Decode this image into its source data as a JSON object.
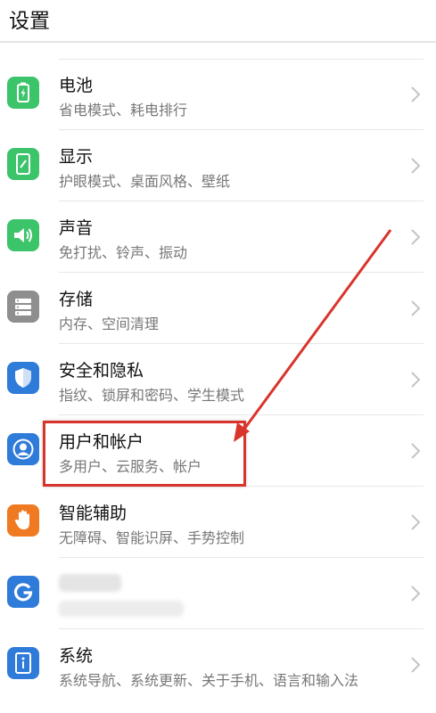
{
  "header": {
    "title": "设置"
  },
  "items": [
    {
      "title": "电池",
      "subtitle": "省电模式、耗电排行",
      "icon": "battery-icon",
      "color": "#3cc46a"
    },
    {
      "title": "显示",
      "subtitle": "护眼模式、桌面风格、壁纸",
      "icon": "display-icon",
      "color": "#3cc46a"
    },
    {
      "title": "声音",
      "subtitle": "免打扰、铃声、振动",
      "icon": "sound-icon",
      "color": "#3cc46a"
    },
    {
      "title": "存储",
      "subtitle": "内存、空间清理",
      "icon": "storage-icon",
      "color": "#8e8e8e"
    },
    {
      "title": "安全和隐私",
      "subtitle": "指纹、锁屏和密码、学生模式",
      "icon": "shield-icon",
      "color": "#2f7bd9"
    },
    {
      "title": "用户和帐户",
      "subtitle": "多用户、云服务、帐户",
      "icon": "user-icon",
      "color": "#2f7bd9"
    },
    {
      "title": "智能辅助",
      "subtitle": "无障碍、智能识屏、手势控制",
      "icon": "hand-icon",
      "color": "#f07a22"
    },
    {
      "title": "",
      "subtitle": "",
      "icon": "google-icon",
      "color": "#2f7bd9"
    },
    {
      "title": "系统",
      "subtitle": "系统导航、系统更新、关于手机、语言和输入法",
      "icon": "info-icon",
      "color": "#2f7bd9"
    }
  ]
}
